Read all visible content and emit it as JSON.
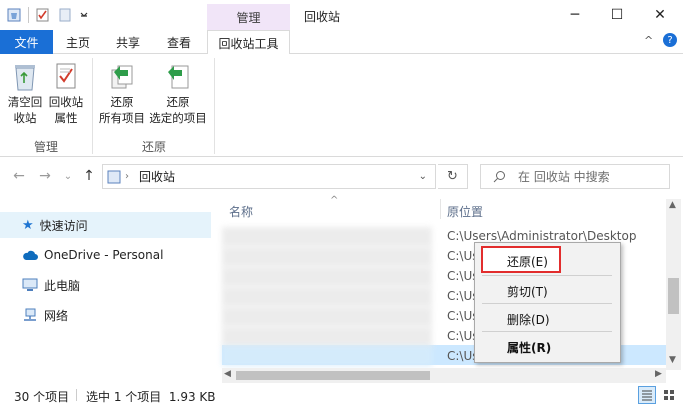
{
  "titlebar": {
    "context_tab_label": "管理",
    "window_title": "回收站",
    "minimize": "─",
    "maximize": "☐",
    "close": "✕"
  },
  "tabs": {
    "file": "文件",
    "home": "主页",
    "share": "共享",
    "view": "查看",
    "tools": "回收站工具"
  },
  "ribbon": {
    "empty_bin": [
      "清空回",
      "收站"
    ],
    "bin_props": [
      "回收站",
      "属性"
    ],
    "group_manage": "管理",
    "restore_all": [
      "还原",
      "所有项目"
    ],
    "restore_selected": [
      "还原",
      "选定的项目"
    ],
    "group_restore": "还原",
    "collapse_icon": "^",
    "help_icon": "?"
  },
  "address": {
    "path": "回收站",
    "search_placeholder": "在 回收站 中搜索"
  },
  "sidebar": {
    "items": [
      {
        "label": "快速访问"
      },
      {
        "label": "OneDrive - Personal"
      },
      {
        "label": "此电脑"
      },
      {
        "label": "网络"
      }
    ]
  },
  "filelist": {
    "col_name": "名称",
    "col_location": "原位置",
    "locations": [
      "C:\\Users\\Administrator\\Desktop",
      "C:\\Us",
      "C:\\Us",
      "C:\\Us",
      "C:\\Us",
      "C:\\Us",
      "C:\\Us"
    ]
  },
  "context_menu": {
    "restore": "还原(E)",
    "cut": "剪切(T)",
    "delete": "删除(D)",
    "properties": "属性(R)"
  },
  "status": {
    "count": "30 个项目",
    "selection": "选中 1 个项目  1.93 KB"
  },
  "colors": {
    "accent": "#1a6fd6",
    "selection": "#cce8ff",
    "highlight_box": "#e22d2d"
  }
}
